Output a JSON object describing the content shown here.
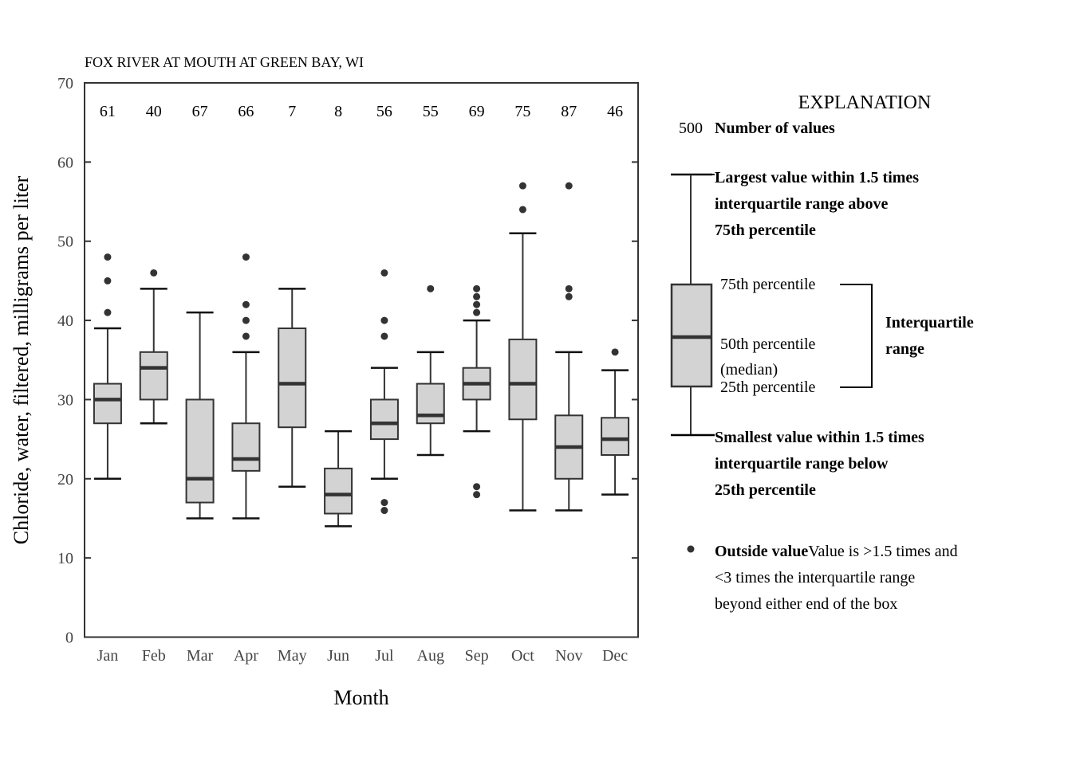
{
  "chart_data": {
    "type": "boxplot",
    "title": "FOX RIVER AT MOUTH AT GREEN BAY, WI",
    "xlabel": "Month",
    "ylabel": "Chloride, water, filtered, milligrams per liter",
    "ylim": [
      0,
      70
    ],
    "yticks": [
      0,
      10,
      20,
      30,
      40,
      50,
      60,
      70
    ],
    "grid": false,
    "categories": [
      "Jan",
      "Feb",
      "Mar",
      "Apr",
      "May",
      "Jun",
      "Jul",
      "Aug",
      "Sep",
      "Oct",
      "Nov",
      "Dec"
    ],
    "counts": [
      61,
      40,
      67,
      66,
      7,
      8,
      56,
      55,
      69,
      75,
      87,
      46
    ],
    "boxes": [
      {
        "month": "Jan",
        "whisker_low": 20,
        "q1": 27,
        "median": 30,
        "q3": 32,
        "whisker_high": 39,
        "outliers": [
          41,
          45,
          48
        ]
      },
      {
        "month": "Feb",
        "whisker_low": 27,
        "q1": 30,
        "median": 34,
        "q3": 36,
        "whisker_high": 44,
        "outliers": [
          46
        ]
      },
      {
        "month": "Mar",
        "whisker_low": 15,
        "q1": 17,
        "median": 20,
        "q3": 30,
        "whisker_high": 41,
        "outliers": []
      },
      {
        "month": "Apr",
        "whisker_low": 15,
        "q1": 21,
        "median": 22.5,
        "q3": 27,
        "whisker_high": 36,
        "outliers": [
          38,
          40,
          42,
          48
        ]
      },
      {
        "month": "May",
        "whisker_low": 19,
        "q1": 26.5,
        "median": 32,
        "q3": 39,
        "whisker_high": 44,
        "outliers": []
      },
      {
        "month": "Jun",
        "whisker_low": 14,
        "q1": 15.6,
        "median": 18,
        "q3": 21.3,
        "whisker_high": 26,
        "outliers": []
      },
      {
        "month": "Jul",
        "whisker_low": 20,
        "q1": 25,
        "median": 27,
        "q3": 30,
        "whisker_high": 34,
        "outliers": [
          16,
          17,
          38,
          40,
          46
        ]
      },
      {
        "month": "Aug",
        "whisker_low": 23,
        "q1": 27,
        "median": 28,
        "q3": 32,
        "whisker_high": 36,
        "outliers": [
          44
        ]
      },
      {
        "month": "Sep",
        "whisker_low": 26,
        "q1": 30,
        "median": 32,
        "q3": 34,
        "whisker_high": 40,
        "outliers": [
          18,
          19,
          41,
          42,
          43,
          44
        ]
      },
      {
        "month": "Oct",
        "whisker_low": 16,
        "q1": 27.5,
        "median": 32,
        "q3": 37.6,
        "whisker_high": 51,
        "outliers": [
          54,
          57
        ]
      },
      {
        "month": "Nov",
        "whisker_low": 16,
        "q1": 20,
        "median": 24,
        "q3": 28,
        "whisker_high": 36,
        "outliers": [
          43,
          44,
          57
        ]
      },
      {
        "month": "Dec",
        "whisker_low": 18,
        "q1": 23,
        "median": 25,
        "q3": 27.7,
        "whisker_high": 33.7,
        "outliers": [
          36
        ]
      }
    ],
    "colors": {
      "box_fill": "#d3d3d3",
      "box_stroke": "#333333",
      "outlier": "#333333",
      "axis": "#333333"
    },
    "legend": {
      "placement": "right",
      "heading": "EXPLANATION",
      "count_example": "500",
      "count_label": "Number of values",
      "upper_whisker_lines": [
        "Largest value within 1.5 times",
        "interquartile range above",
        "75th percentile"
      ],
      "q3_label": "75th percentile",
      "median_lines": [
        "50th percentile",
        "(median)"
      ],
      "q1_label": "25th percentile",
      "iqr_lines": [
        "Interquartile",
        "range"
      ],
      "lower_whisker_lines": [
        "Smallest value within 1.5 times",
        "interquartile range below",
        "25th percentile"
      ],
      "outlier_bold": "Outside value",
      "outlier_lines": [
        "Value is >1.5 times and",
        "<3 times the interquartile range",
        "beyond either end of the box"
      ]
    }
  }
}
